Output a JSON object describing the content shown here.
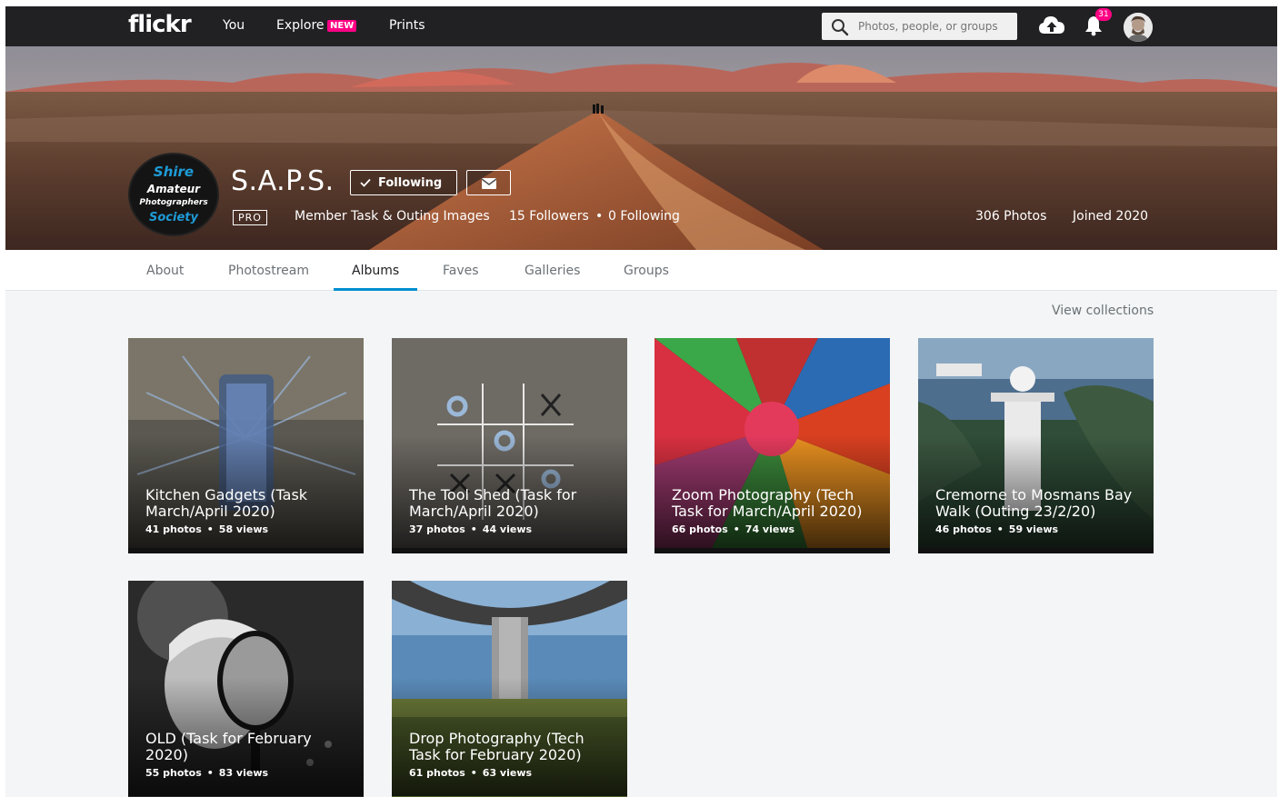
{
  "nav": {
    "logo": "flickr",
    "you": "You",
    "explore": "Explore",
    "explore_badge": "NEW",
    "prints": "Prints",
    "search_placeholder": "Photos, people, or groups",
    "notification_count": "31"
  },
  "profile": {
    "logo_lines": [
      "Shire",
      "Amateur",
      "Photographers",
      "Society"
    ],
    "name": "S.A.P.S.",
    "following_label": "Following",
    "pro_badge": "PRO",
    "description": "Member Task & Outing Images",
    "followers": "15 Followers",
    "following": "0 Following",
    "photos": "306 Photos",
    "joined": "Joined 2020"
  },
  "tabs": [
    "About",
    "Photostream",
    "Albums",
    "Faves",
    "Galleries",
    "Groups"
  ],
  "active_tab": "Albums",
  "view_collections": "View collections",
  "albums": [
    {
      "title": "Kitchen Gadgets (Task March/April 2020)",
      "photos": "41 photos",
      "views": "58 views"
    },
    {
      "title": "The Tool Shed (Task for March/April 2020)",
      "photos": "37 photos",
      "views": "44 views"
    },
    {
      "title": "Zoom Photography (Tech Task for March/April 2020)",
      "photos": "66 photos",
      "views": "74 views"
    },
    {
      "title": "Cremorne to Mosmans Bay Walk (Outing 23/2/20)",
      "photos": "46 photos",
      "views": "59 views"
    },
    {
      "title": "OLD (Task for February 2020)",
      "photos": "55 photos",
      "views": "83 views"
    },
    {
      "title": "Drop Photography (Tech Task for February 2020)",
      "photos": "61 photos",
      "views": "63 views"
    }
  ],
  "colors": {
    "nav_bg": "#212124",
    "accent_pink": "#ff0084",
    "tab_active_blue": "#008ecf"
  }
}
